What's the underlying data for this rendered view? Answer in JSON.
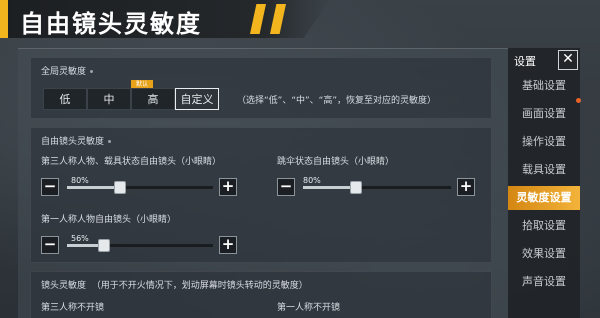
{
  "banner": {
    "title": "自由镜头灵敏度"
  },
  "global": {
    "title": "全局灵敏度",
    "options": [
      "低",
      "中",
      "高",
      "自定义"
    ],
    "selected": "自定义",
    "default_tag": "默认",
    "hint": "（选择“低”、“中”、“高”，恢复至对应的灵敏度）"
  },
  "free_camera": {
    "title": "自由镜头灵敏度",
    "third_person": {
      "label": "第三人称人物、载具状态自由镜头（小眼睛）",
      "value": "80%",
      "level": 0.8
    },
    "parachute": {
      "label": "跳伞状态自由镜头（小眼睛）",
      "value": "80%",
      "level": 0.8
    },
    "first_person": {
      "label": "第一人称人物自由镜头（小眼睛）",
      "value": "56%",
      "level": 0.56
    },
    "minus": "−",
    "plus": "+"
  },
  "camera": {
    "title": "镜头灵敏度",
    "hint": "（用于不开火情况下，划动屏幕时镜头转动的灵敏度）",
    "third_no_scope": "第三人称不开镜",
    "first_no_scope": "第一人称不开镜"
  },
  "menu": {
    "title": "设置",
    "close": "✕",
    "items": [
      "基础设置",
      "画面设置",
      "操作设置",
      "载具设置",
      "灵敏度设置",
      "拾取设置",
      "效果设置",
      "声音设置"
    ],
    "active": "灵敏度设置"
  },
  "colors": {
    "accent": "#f2b51d",
    "active_menu": "#e89a1e",
    "notify_dot": "#e8622a"
  }
}
